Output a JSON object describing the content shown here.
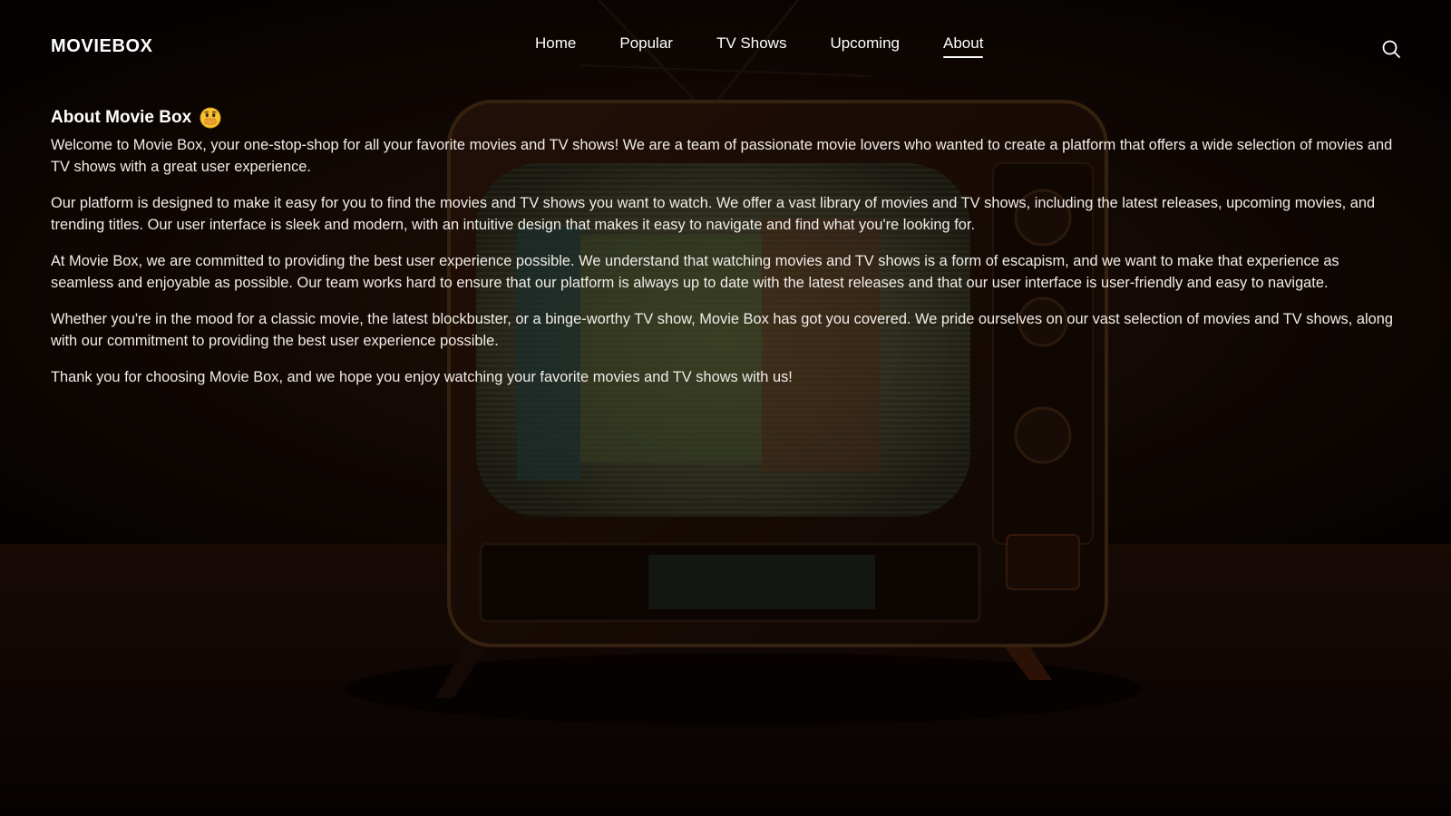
{
  "brand": {
    "logo": "MOVIEBOX"
  },
  "nav": {
    "items": [
      {
        "label": "Home",
        "active": false
      },
      {
        "label": "Popular",
        "active": false
      },
      {
        "label": "TV Shows",
        "active": false
      },
      {
        "label": "Upcoming",
        "active": false
      },
      {
        "label": "About",
        "active": true
      }
    ],
    "search_icon": "search-icon"
  },
  "about": {
    "title": "About Movie Box",
    "title_emoji": "face-with-hand-over-mouth-emoji",
    "paragraphs": [
      "Welcome to Movie Box, your one-stop-shop for all your favorite movies and TV shows! We are a team of passionate movie lovers who wanted to create a platform that offers a wide selection of movies and TV shows with a great user experience.",
      "Our platform is designed to make it easy for you to find the movies and TV shows you want to watch. We offer a vast library of movies and TV shows, including the latest releases, upcoming movies, and trending titles. Our user interface is sleek and modern, with an intuitive design that makes it easy to navigate and find what you're looking for.",
      "At Movie Box, we are committed to providing the best user experience possible. We understand that watching movies and TV shows is a form of escapism, and we want to make that experience as seamless and enjoyable as possible. Our team works hard to ensure that our platform is always up to date with the latest releases and that our user interface is user-friendly and easy to navigate.",
      "Whether you're in the mood for a classic movie, the latest blockbuster, or a binge-worthy TV show, Movie Box has got you covered. We pride ourselves on our vast selection of movies and TV shows, along with our commitment to providing the best user experience possible.",
      "Thank you for choosing Movie Box, and we hope you enjoy watching your favorite movies and TV shows with us!"
    ]
  },
  "colors": {
    "background": "#0d0705",
    "text": "#ffffff",
    "body_text": "#f1ece8"
  }
}
